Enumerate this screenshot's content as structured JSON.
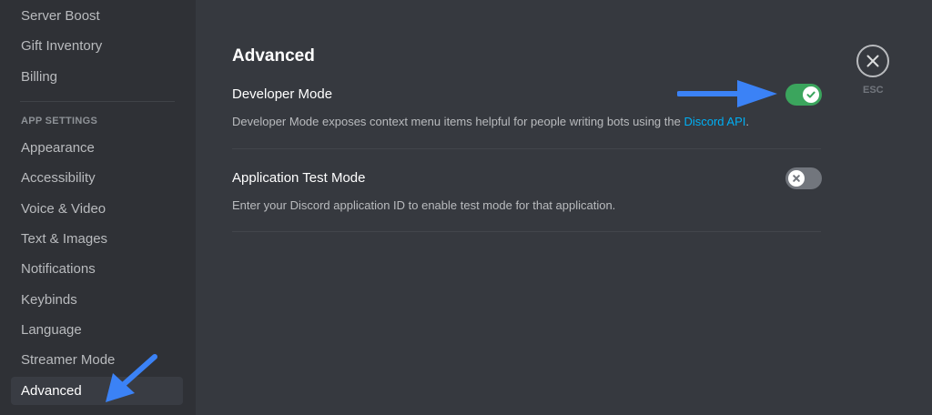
{
  "sidebar": {
    "items_top": [
      {
        "label": "Server Boost"
      },
      {
        "label": "Gift Inventory"
      },
      {
        "label": "Billing"
      }
    ],
    "section_header": "APP SETTINGS",
    "items": [
      {
        "label": "Appearance"
      },
      {
        "label": "Accessibility"
      },
      {
        "label": "Voice & Video"
      },
      {
        "label": "Text & Images"
      },
      {
        "label": "Notifications"
      },
      {
        "label": "Keybinds"
      },
      {
        "label": "Language"
      },
      {
        "label": "Streamer Mode"
      },
      {
        "label": "Advanced",
        "selected": true
      }
    ]
  },
  "content": {
    "title": "Advanced",
    "settings": [
      {
        "title": "Developer Mode",
        "desc_prefix": "Developer Mode exposes context menu items helpful for people writing bots using the ",
        "desc_link": "Discord API",
        "desc_suffix": ".",
        "enabled": true
      },
      {
        "title": "Application Test Mode",
        "desc": "Enter your Discord application ID to enable test mode for that application.",
        "enabled": false
      }
    ]
  },
  "close": {
    "label": "ESC",
    "icon": "close-icon"
  },
  "colors": {
    "toggle_on": "#3ba55d",
    "toggle_off": "#72767d",
    "link": "#00aff4",
    "annotation_arrow": "#3b82f6"
  }
}
